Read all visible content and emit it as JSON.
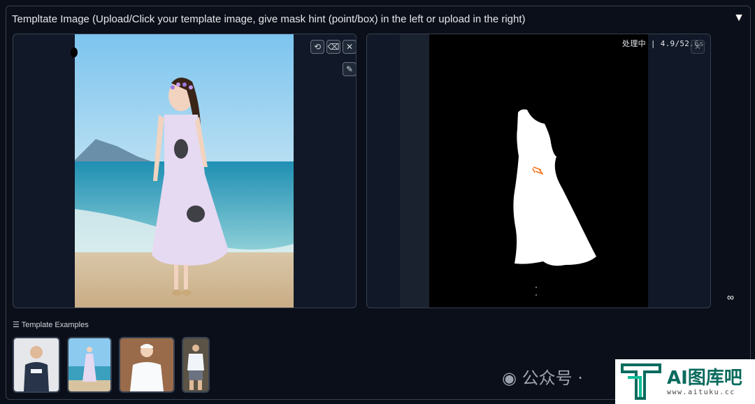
{
  "header": {
    "title": "Templtate Image (Upload/Click your template image, give mask hint (point/box) in the left or upload in the right)"
  },
  "left_panel": {
    "toolbar": [
      "undo-icon",
      "eraser-icon",
      "close-icon"
    ],
    "brush_tool": "brush-icon"
  },
  "right_panel": {
    "progress_text": "处理中 | 4.9/52.6s",
    "close_icon": "close-icon"
  },
  "examples": {
    "label": "Template Examples",
    "items": [
      {
        "name": "example-man-navy-tee"
      },
      {
        "name": "example-woman-beach-dress"
      },
      {
        "name": "example-woman-white-tee"
      },
      {
        "name": "example-man-white-tee"
      }
    ]
  },
  "watermark": {
    "text": "公众号 ·"
  },
  "logo": {
    "title": "AI图库吧",
    "url": "www.aituku.cc"
  },
  "colors": {
    "background": "#0b0f19",
    "border": "#374151",
    "panel": "#111827",
    "mask_highlight": "#f97316"
  }
}
